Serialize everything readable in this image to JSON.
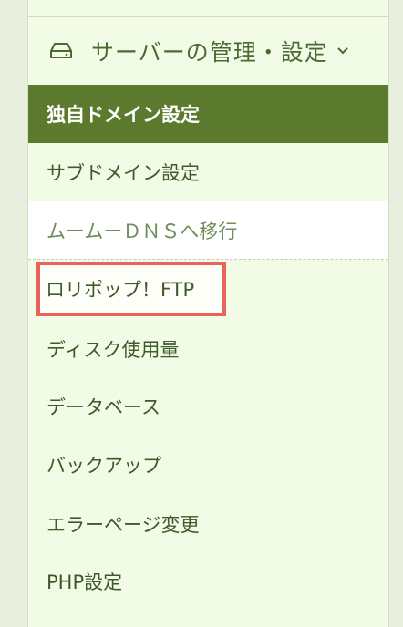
{
  "section": {
    "title": "サーバーの管理・設定",
    "icon": "hard-drive-icon",
    "toggle_icon": "chevron-down-icon"
  },
  "menu": {
    "items": [
      {
        "label": "独自ドメイン設定",
        "state": "active"
      },
      {
        "label": "サブドメイン設定"
      },
      {
        "label": "ムームーＤＮＳへ移行"
      },
      {
        "label": "ロリポップ！FTP",
        "state": "highlighted"
      },
      {
        "label": "ディスク使用量"
      },
      {
        "label": "データベース"
      },
      {
        "label": "バックアップ"
      },
      {
        "label": "エラーページ変更"
      },
      {
        "label": "PHP設定"
      }
    ]
  },
  "colors": {
    "active_bg": "#5c7a2e",
    "panel_bg": "#f2fbe6",
    "text": "#3f5a2a",
    "highlight_border": "#e8645a"
  }
}
